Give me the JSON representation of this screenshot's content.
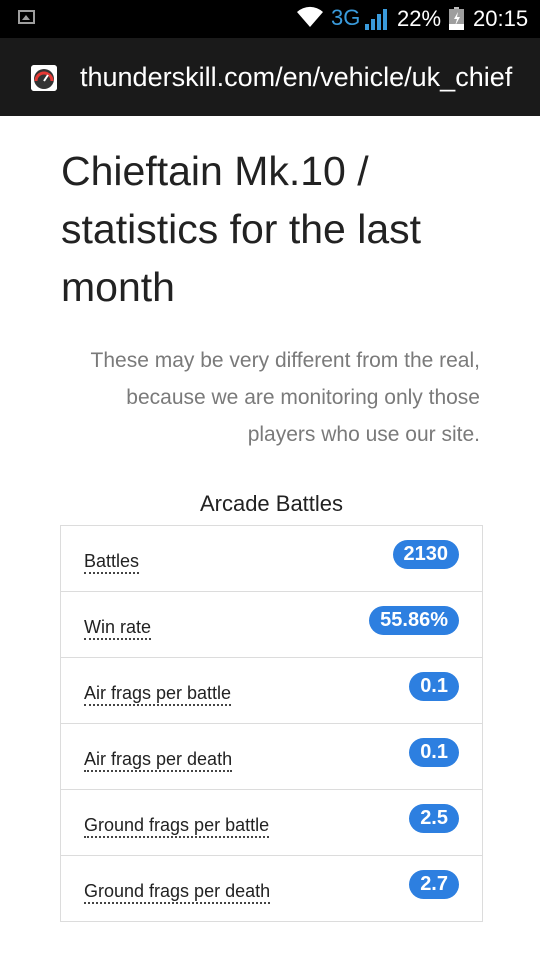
{
  "status_bar": {
    "network": "3G",
    "battery": "22%",
    "time": "20:15",
    "icons": [
      "gallery-icon",
      "wifi-icon",
      "signal-icon",
      "battery-icon"
    ],
    "network_color": "#3a9bdc"
  },
  "browser": {
    "url": "thunderskill.com/en/vehicle/uk_chief",
    "favicon": "thunderskill-favicon-icon"
  },
  "page": {
    "title": "Chieftain Mk.10 / statistics for the last month",
    "disclaimer": "These may be very different from the real, because we are monitoring only those players who use our site.",
    "section_heading": "Arcade Battles",
    "stats": [
      {
        "label": "Battles",
        "value": "2130"
      },
      {
        "label": "Win rate",
        "value": "55.86%"
      },
      {
        "label": "Air frags per battle",
        "value": "0.1"
      },
      {
        "label": "Air frags per death",
        "value": "0.1"
      },
      {
        "label": "Ground frags per battle",
        "value": "2.5"
      },
      {
        "label": "Ground frags per death",
        "value": "2.7"
      }
    ],
    "badge_color": "#2d7fe0"
  }
}
